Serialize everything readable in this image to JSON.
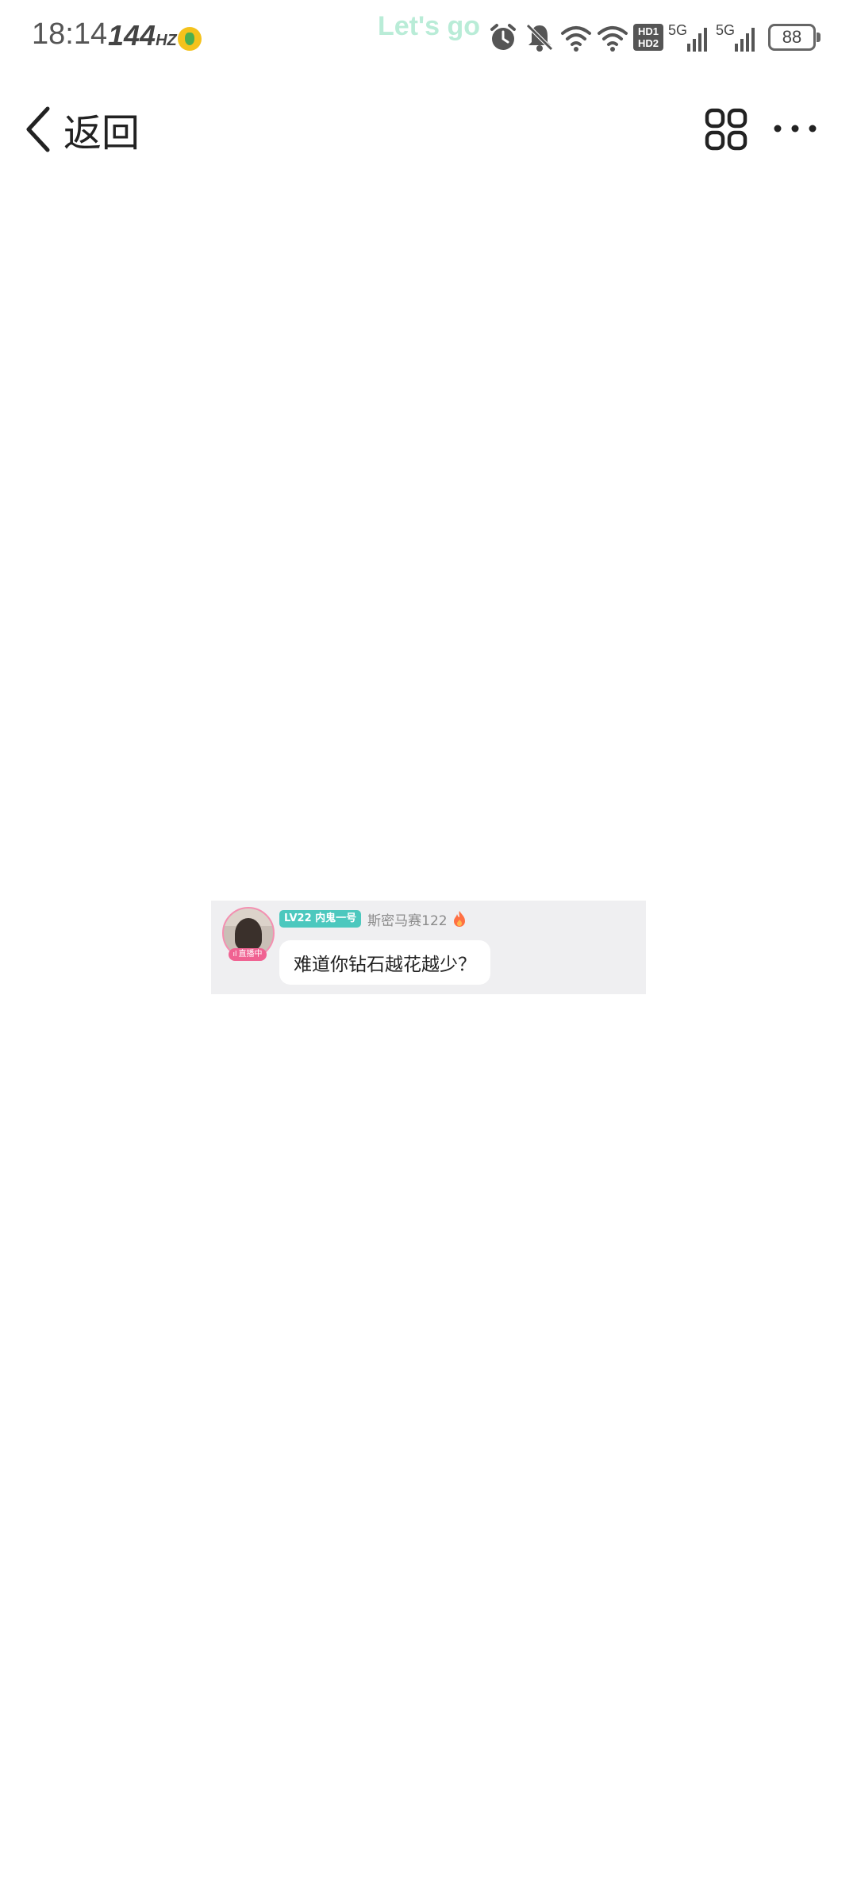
{
  "status_bar": {
    "time": "18:14",
    "refresh_rate": "144",
    "refresh_unit": "HZ",
    "ticker_text": "Let's go",
    "network_1": "5G",
    "network_2": "5G",
    "hd_line_1": "HD1",
    "hd_line_2": "HD2",
    "battery": "88",
    "icons": [
      "app-notification-icon",
      "alarm-icon",
      "mute-bell-icon",
      "wifi-icon",
      "wifi-icon",
      "hd-icon",
      "signal-icon",
      "signal-icon",
      "battery-icon"
    ]
  },
  "nav": {
    "back_label": "返回",
    "icons": [
      "back-arrow-icon",
      "grid-icon",
      "more-icon"
    ]
  },
  "message": {
    "level_badge": "LV22 内鬼一号",
    "username": "斯密马赛122",
    "live_label": "直播中",
    "text": "难道你钻石越花越少？",
    "colors": {
      "badge": "#4cc8be",
      "live_pill": "#f06292",
      "card_bg": "#efeff1"
    }
  }
}
